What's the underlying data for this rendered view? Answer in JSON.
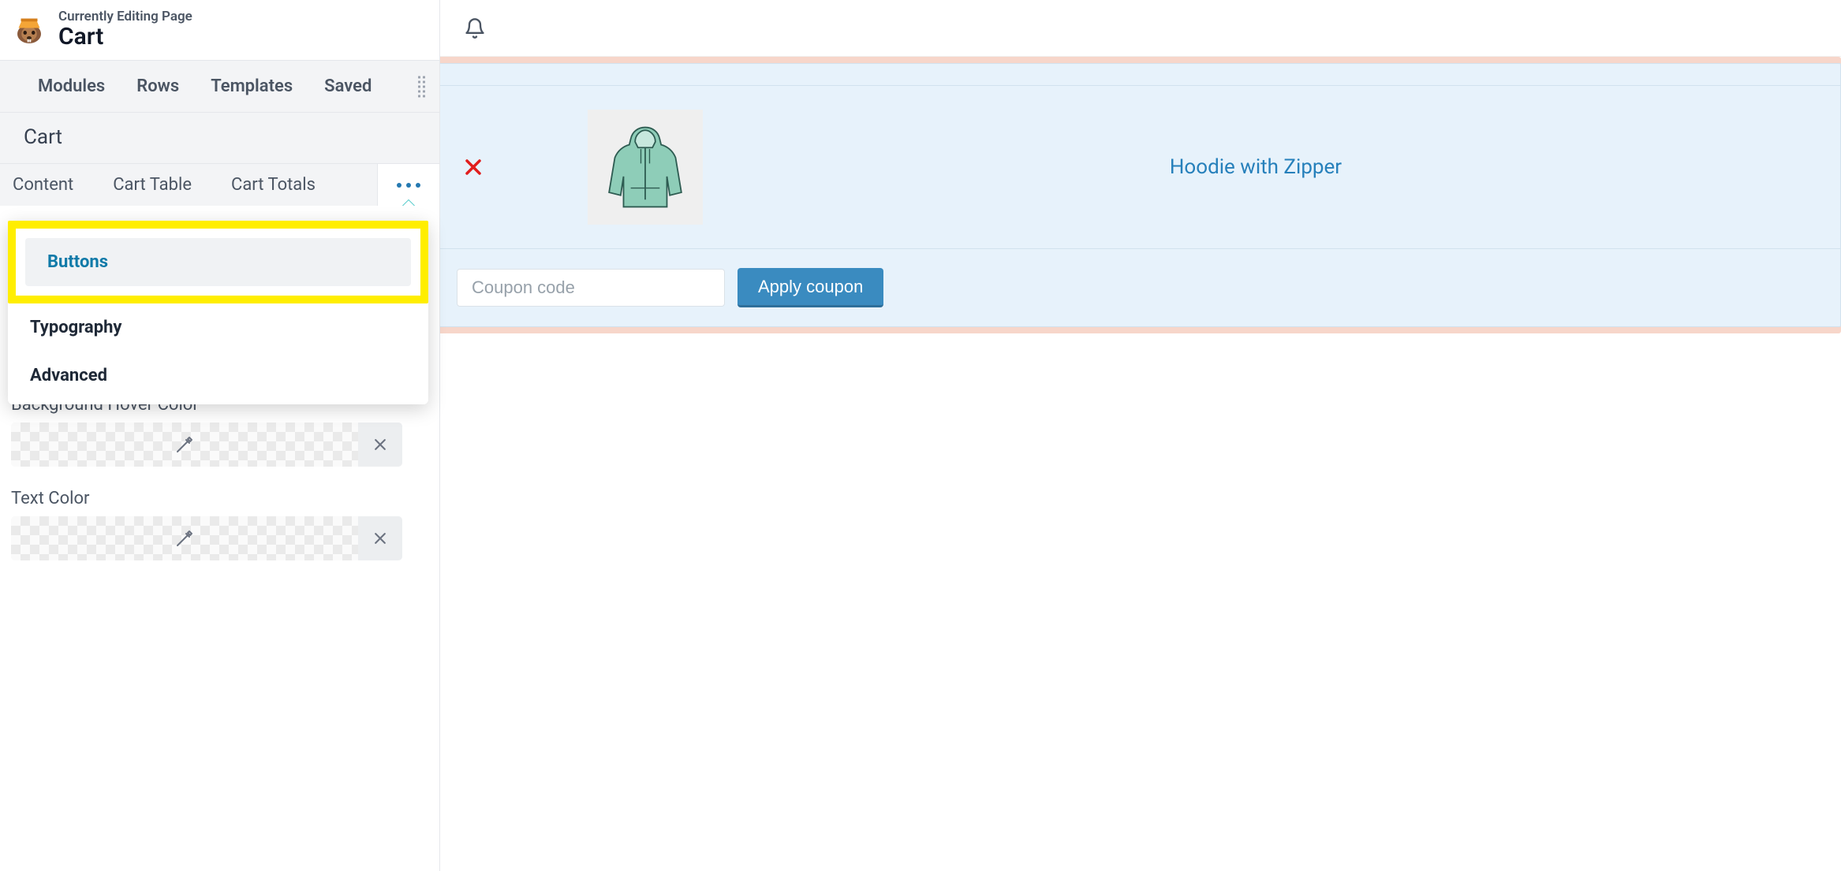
{
  "header": {
    "subtitle": "Currently Editing Page",
    "title": "Cart"
  },
  "top_tabs": [
    "Modules",
    "Rows",
    "Templates",
    "Saved"
  ],
  "section_label": "Cart",
  "sub_tabs": [
    "Content",
    "Cart Table",
    "Cart Totals"
  ],
  "dropdown": {
    "items": [
      "Buttons",
      "Typography",
      "Advanced"
    ],
    "active_index": 0
  },
  "color_section": {
    "label_hover": "Background Hover Color",
    "label_text": "Text Color"
  },
  "product": {
    "name": "Hoodie with Zipper"
  },
  "coupon": {
    "placeholder": "Coupon code",
    "button_label": "Apply coupon"
  }
}
